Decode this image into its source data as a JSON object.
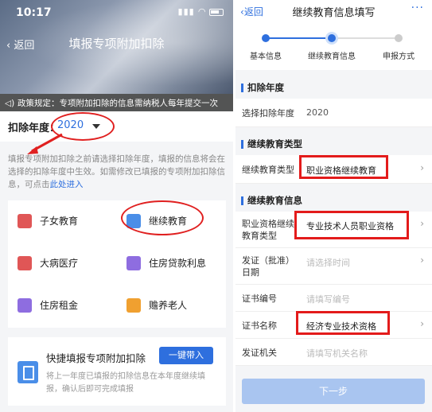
{
  "left": {
    "status_time": "10:17",
    "nav_back": "返回",
    "nav_title": "填报专项附加扣除",
    "notice": "政策规定：专项附加扣除的信息需纳税人每年提交一次",
    "year_label": "扣除年度：",
    "year_value": "2020",
    "desc_text": "填报专项附加扣除之前请选择扣除年度，填报的信息将会在选择的扣除年度中生效。如需修改已填报的专项附加扣除信息，可点击",
    "desc_link": "此处进入",
    "categories": [
      {
        "label": "子女教育",
        "color": "#e05656"
      },
      {
        "label": "继续教育",
        "color": "#4a8ee8"
      },
      {
        "label": "大病医疗",
        "color": "#e05656"
      },
      {
        "label": "住房贷款利息",
        "color": "#8e6de0"
      },
      {
        "label": "住房租金",
        "color": "#8e6de0"
      },
      {
        "label": "赡养老人",
        "color": "#f0a030"
      }
    ],
    "quick_title": "快捷填报专项附加扣除",
    "quick_button": "一键带入",
    "quick_desc": "将上一年度已填报的扣除信息在本年度继续填报，确认后即可完成填报"
  },
  "right": {
    "nav_back": "返回",
    "nav_title": "继续教育信息填写",
    "nav_more": "···",
    "steps": [
      "基本信息",
      "继续教育信息",
      "申报方式"
    ],
    "sections": {
      "year": "扣除年度",
      "type": "继续教育类型",
      "info": "继续教育信息"
    },
    "rows": {
      "select_year_key": "选择扣除年度",
      "select_year_val": "2020",
      "edu_type_key": "继续教育类型",
      "edu_type_val": "职业资格继续教育",
      "qual_type_key": "职业资格继续教育类型",
      "qual_type_val": "专业技术人员职业资格",
      "issue_date_key": "发证（批准）日期",
      "issue_date_ph": "请选择时间",
      "cert_no_key": "证书编号",
      "cert_no_ph": "请填写编号",
      "cert_name_key": "证书名称",
      "cert_name_val": "经济专业技术资格",
      "authority_key": "发证机关",
      "authority_ph": "请填写机关名称"
    },
    "next_button": "下一步"
  },
  "colors": {
    "accent": "#2e6fde",
    "highlight": "#e31b1b"
  }
}
